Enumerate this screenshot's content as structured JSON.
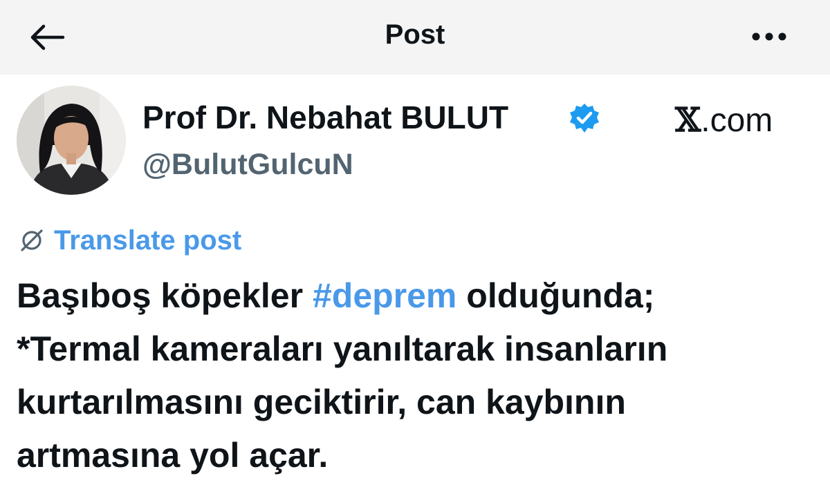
{
  "header": {
    "title": "Post",
    "back_icon": "arrow-left-icon",
    "more_icon": "more-horizontal-icon"
  },
  "author": {
    "display_name": "Prof Dr. Nebahat BULUT",
    "handle": "@BulutGulcuN",
    "verified_icon": "verified-badge-icon",
    "verified_color": "#1d9bf0"
  },
  "brand": {
    "x_glyph": "𝕏",
    "suffix": ".com"
  },
  "translate": {
    "label": "Translate post",
    "icon": "translate-globe-icon",
    "color": "#4a99e9"
  },
  "post": {
    "line1_before": "Başıboş köpekler ",
    "hashtag": "#deprem",
    "line1_after": " olduğunda;",
    "line2": "*Termal kameraları yanıltarak insanların",
    "line3": "kurtarılmasını geciktirir, can kaybının",
    "line4": "artmasına yol açar."
  }
}
